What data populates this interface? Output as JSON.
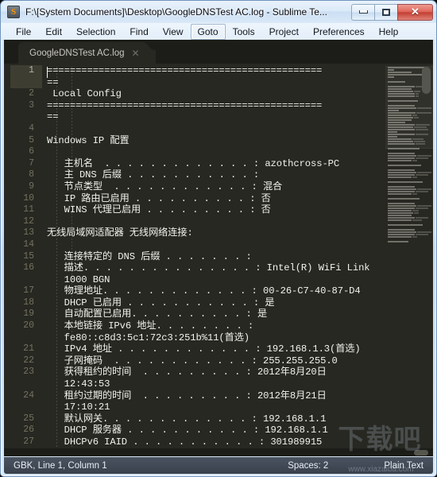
{
  "window": {
    "title": "F:\\[System Documents]\\Desktop\\GoogleDNSTest AC.log - Sublime Te...",
    "app_icon": "sublime-s-icon",
    "buttons": {
      "minimize": "minimize-icon",
      "maximize": "maximize-icon",
      "close": "✕"
    }
  },
  "menubar": {
    "items": [
      {
        "label": "File",
        "active": false
      },
      {
        "label": "Edit",
        "active": false
      },
      {
        "label": "Selection",
        "active": false
      },
      {
        "label": "Find",
        "active": false
      },
      {
        "label": "View",
        "active": false
      },
      {
        "label": "Goto",
        "active": true
      },
      {
        "label": "Tools",
        "active": false
      },
      {
        "label": "Project",
        "active": false
      },
      {
        "label": "Preferences",
        "active": false
      },
      {
        "label": "Help",
        "active": false
      }
    ]
  },
  "tabs": [
    {
      "label": "GoogleDNSTest AC.log",
      "close": "✕",
      "active": true
    }
  ],
  "editor": {
    "cursor_line": 1,
    "lines": [
      {
        "n": 1,
        "text": "================================================"
      },
      {
        "n": "",
        "text": "=="
      },
      {
        "n": 2,
        "text": " Local Config"
      },
      {
        "n": 3,
        "text": "================================================"
      },
      {
        "n": "",
        "text": "=="
      },
      {
        "n": 4,
        "text": ""
      },
      {
        "n": 5,
        "text": "Windows IP 配置"
      },
      {
        "n": 6,
        "text": ""
      },
      {
        "n": 7,
        "text": "   主机名  . . . . . . . . . . . . . : azothcross-PC"
      },
      {
        "n": 8,
        "text": "   主 DNS 后缀 . . . . . . . . . . . :"
      },
      {
        "n": 9,
        "text": "   节点类型  . . . . . . . . . . . . : 混合"
      },
      {
        "n": 10,
        "text": "   IP 路由已启用 . . . . . . . . . . : 否"
      },
      {
        "n": 11,
        "text": "   WINS 代理已启用 . . . . . . . . . : 否"
      },
      {
        "n": 12,
        "text": ""
      },
      {
        "n": 13,
        "text": "无线局域网适配器 无线网络连接:"
      },
      {
        "n": 14,
        "text": ""
      },
      {
        "n": 15,
        "text": "   连接特定的 DNS 后缀 . . . . . . . :"
      },
      {
        "n": 16,
        "text": "   描述. . . . . . . . . . . . . . . : Intel(R) WiFi Link"
      },
      {
        "n": "",
        "text": "   1000 BGN"
      },
      {
        "n": 17,
        "text": "   物理地址. . . . . . . . . . . . . : 00-26-C7-40-87-D4"
      },
      {
        "n": 18,
        "text": "   DHCP 已启用 . . . . . . . . . . . : 是"
      },
      {
        "n": 19,
        "text": "   自动配置已启用. . . . . . . . . . : 是"
      },
      {
        "n": 20,
        "text": "   本地链接 IPv6 地址. . . . . . . . :"
      },
      {
        "n": "",
        "text": "   fe80::c8d3:5c1:72c3:251b%11(首选)"
      },
      {
        "n": 21,
        "text": "   IPv4 地址 . . . . . . . . . . . . : 192.168.1.3(首选)"
      },
      {
        "n": 22,
        "text": "   子网掩码  . . . . . . . . . . . . : 255.255.255.0"
      },
      {
        "n": 23,
        "text": "   获得租约的时间  . . . . . . . . . : 2012年8月20日"
      },
      {
        "n": "",
        "text": "   12:43:53"
      },
      {
        "n": 24,
        "text": "   租约过期的时间  . . . . . . . . . : 2012年8月21日"
      },
      {
        "n": "",
        "text": "   17:10:21"
      },
      {
        "n": 25,
        "text": "   默认网关. . . . . . . . . . . . . : 192.168.1.1"
      },
      {
        "n": 26,
        "text": "   DHCP 服务器 . . . . . . . . . . . : 192.168.1.1"
      },
      {
        "n": 27,
        "text": "   DHCPv6 IAID . . . . . . . . . . . : 301989915"
      }
    ]
  },
  "minimap": {
    "rows": [
      [
        46
      ],
      [
        8
      ],
      [
        30
      ],
      [
        46
      ],
      [
        8
      ],
      [
        0
      ],
      [
        22
      ],
      [
        0
      ],
      [
        34,
        14
      ],
      [
        30
      ],
      [
        32,
        8
      ],
      [
        34,
        4
      ],
      [
        34,
        4
      ],
      [
        0
      ],
      [
        38
      ],
      [
        0
      ],
      [
        34
      ],
      [
        36,
        18
      ],
      [
        14
      ],
      [
        36,
        20
      ],
      [
        30,
        6
      ],
      [
        32,
        6
      ],
      [
        30
      ],
      [
        22
      ],
      [
        34,
        18
      ],
      [
        32,
        16
      ],
      [
        34,
        16
      ],
      [
        12
      ],
      [
        34,
        16
      ],
      [
        12
      ],
      [
        30,
        14
      ],
      [
        32,
        14
      ],
      [
        34,
        12
      ],
      [
        0
      ],
      [
        40
      ],
      [
        0
      ],
      [
        34
      ],
      [
        36,
        18
      ],
      [
        34,
        16
      ],
      [
        30,
        6
      ],
      [
        0
      ],
      [
        42
      ],
      [
        0
      ],
      [
        34
      ],
      [
        36,
        18
      ],
      [
        34,
        16
      ],
      [
        30,
        6
      ],
      [
        0
      ],
      [
        44
      ],
      [
        0
      ],
      [
        34
      ],
      [
        36,
        18
      ],
      [
        34,
        16
      ],
      [
        30,
        6
      ],
      [
        0
      ],
      [
        40
      ],
      [
        0
      ],
      [
        34
      ],
      [
        36,
        18
      ],
      [
        34,
        16
      ],
      [
        30,
        8
      ],
      [
        32,
        6
      ],
      [
        30
      ],
      [
        34,
        16
      ],
      [
        30,
        12
      ],
      [
        0
      ],
      [
        44
      ],
      [
        0
      ],
      [
        34
      ],
      [
        36,
        18
      ],
      [
        34,
        16
      ],
      [
        30,
        6
      ],
      [
        0
      ],
      [
        26
      ]
    ]
  },
  "statusbar": {
    "left": "GBK, Line 1, Column 1",
    "middle": "Spaces: 2",
    "right": "Plain Text"
  },
  "watermark": {
    "logo": "下载吧",
    "url": "www.xiazaiba.com"
  }
}
